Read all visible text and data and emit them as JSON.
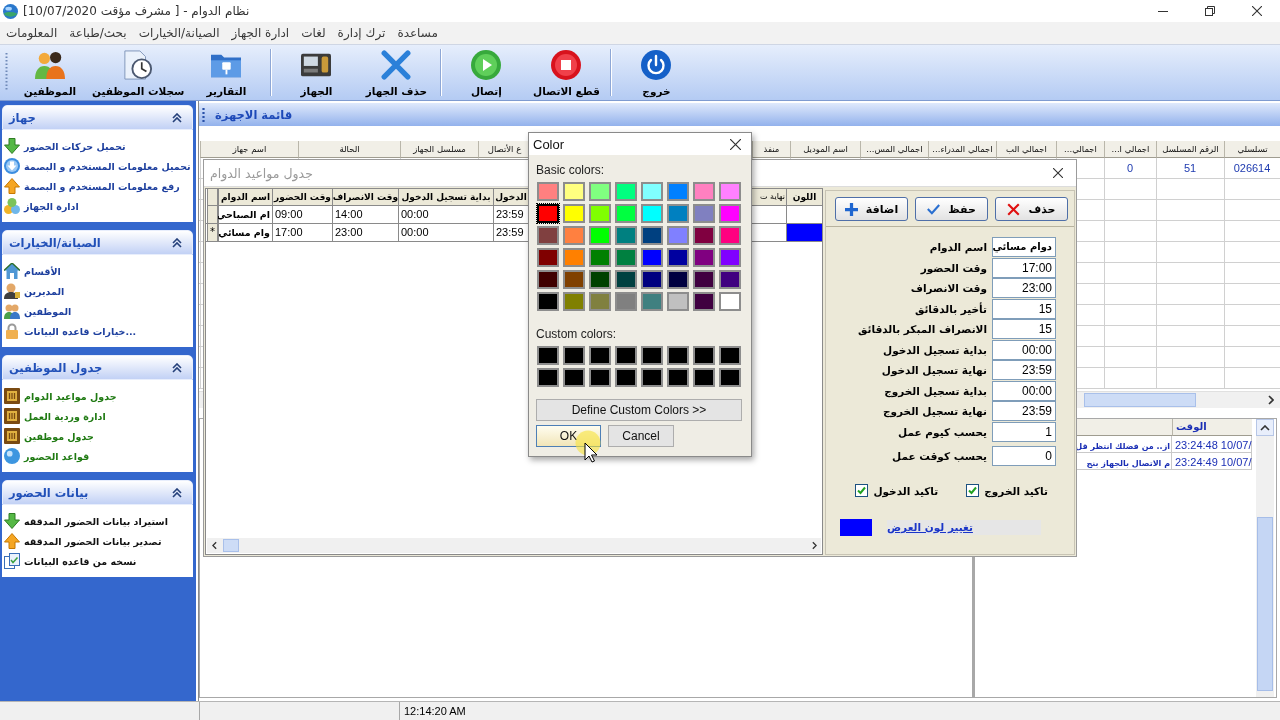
{
  "window": {
    "title": "نظام الدوام - [ مشرف مؤقت 10/07/2020]"
  },
  "menu": [
    "مساعدة",
    "ترك إدارة",
    "لغات",
    "ادارة الجهاز",
    "الصيانة/الخيارات",
    "بحث/طباعة",
    "المعلومات"
  ],
  "toolbar": [
    {
      "buttons": [
        {
          "label": "خروج"
        }
      ]
    },
    {
      "buttons": [
        {
          "label": "قطع الاتصال"
        },
        {
          "label": "إتصال"
        }
      ]
    },
    {
      "buttons": [
        {
          "label": "حذف الجهاز"
        },
        {
          "label": "الجهاز"
        }
      ]
    },
    {
      "buttons": [
        {
          "label": "التقارير"
        },
        {
          "label": "سجلات الموظفين"
        },
        {
          "label": "الموظفين"
        }
      ]
    }
  ],
  "sidebar": {
    "sections": [
      {
        "title": "جهاز",
        "expanded": true,
        "color": "#1d3f9e",
        "items": [
          "تحميل حركات الحضور",
          "تحميل معلومات المستخدم و البصمة",
          "رفع معلومات المستخدم و البصمة",
          "ادارة الجهاز"
        ]
      },
      {
        "title": "الصيانة/الخيارات",
        "expanded": true,
        "color": "#1d3f9e",
        "items": [
          "الأقسام",
          "المديرين",
          "الموظفين",
          "خيارات قاعده البيانات..."
        ]
      },
      {
        "title": "جدول الموظفين",
        "expanded": true,
        "color": "#1f7a12",
        "items": [
          "جدول مواعيد الدوام",
          "ادارة وردية العمل",
          "جدول موظفين",
          "قواعد الحضور"
        ]
      },
      {
        "title": "بيانات الحضور",
        "expanded": true,
        "color": "#111111",
        "items": [
          "استيراد بيانات الحضور المدققه",
          "تصدير بيانات الحضور المدققه",
          "نسخه من قاعده البيانات"
        ]
      }
    ]
  },
  "devices": {
    "title": "قائمة الاجهزة",
    "columns": [
      "تسلسلي",
      "الرقم المسلسل",
      "اجمالي ا...",
      "اجمالي...",
      "اجمالي الب",
      "اجمالي المدراء...",
      "اجمالي المس...",
      "اسم الموديل",
      "منفذ",
      "ع الأتصال",
      "مسلسل الجهاز",
      "الحالة",
      "اسم جهاز"
    ],
    "rows": [
      [
        "026614",
        "51",
        "0"
      ]
    ]
  },
  "log": {
    "time_header": "الوقت",
    "rows": [
      {
        "time": "23:24:48 10/07/",
        "message": "از.. من فضلك انتظر قل"
      },
      {
        "time": "23:24:49 10/07/",
        "message": "م الاتصال بالجهاز بنج"
      }
    ]
  },
  "status_bar": {
    "time": "12:14:20 AM"
  },
  "schedule": {
    "title": "جدول مواعيد الدوام",
    "columns": [
      "اللون",
      "نهاية ت",
      "الدخول",
      "بداية تسجيل الدخول",
      "وقت الانصراف",
      "وقت الحضور",
      "اسم الدوام"
    ],
    "rows": [
      {
        "cells": [
          "",
          "",
          "23:59",
          "00:00",
          "14:00",
          "09:00",
          "ام الصباحي"
        ]
      },
      {
        "color": "#0000ff",
        "cells": [
          "",
          "",
          "23:59",
          "00:00",
          "23:00",
          "17:00",
          "وام مسائي"
        ],
        "marker": "*"
      }
    ],
    "form": {
      "buttons": [
        {
          "label": "حذف"
        },
        {
          "label": "حفظ"
        },
        {
          "label": "اضافة"
        }
      ],
      "fields": [
        {
          "label": "اسم الدوام",
          "value": "دوام مسائي",
          "kind": "text"
        },
        {
          "label": "وقت الحضور",
          "value": "17:00",
          "kind": "time"
        },
        {
          "label": "وقت الانصراف",
          "value": "23:00",
          "kind": "time"
        },
        {
          "label": "تأخير بالدقائق",
          "value": "15",
          "kind": "number"
        },
        {
          "label": "الانصراف المبكر بالدقائق",
          "value": "15",
          "kind": "number"
        },
        {
          "label": "بداية تسجيل الدخول",
          "value": "00:00",
          "kind": "time"
        },
        {
          "label": "نهاية تسجيل الدخول",
          "value": "23:59",
          "kind": "time"
        },
        {
          "label": "بداية تسجيل الخروج",
          "value": "00:00",
          "kind": "time"
        },
        {
          "label": "نهاية تسجيل الخروج",
          "value": "23:59",
          "kind": "time"
        },
        {
          "label": "يحسب كيوم عمل",
          "value": "1",
          "kind": "number"
        },
        {
          "label": "يحسب كوقت عمل",
          "value": "0",
          "kind": "number"
        }
      ],
      "checks": [
        {
          "label": "تاكيد الخروج",
          "checked": true
        },
        {
          "label": "تاكيد الدخول",
          "checked": true
        }
      ],
      "color": "#0000ff",
      "color_link": "تغيير لون العرض"
    }
  },
  "color_dialog": {
    "title": "Color",
    "basic_label": "Basic colors:",
    "basic_colors": [
      {
        "color": "#ff8080",
        "selected": false
      },
      {
        "color": "#ffff80",
        "selected": false
      },
      {
        "color": "#80ff80",
        "selected": false
      },
      {
        "color": "#00ff80",
        "selected": false
      },
      {
        "color": "#80ffff",
        "selected": false
      },
      {
        "color": "#0080ff",
        "selected": false
      },
      {
        "color": "#ff80c0",
        "selected": false
      },
      {
        "color": "#ff80ff",
        "selected": false
      },
      {
        "color": "#ff0000",
        "selected": true
      },
      {
        "color": "#ffff00",
        "selected": false
      },
      {
        "color": "#80ff00",
        "selected": false
      },
      {
        "color": "#00ff40",
        "selected": false
      },
      {
        "color": "#00ffff",
        "selected": false
      },
      {
        "color": "#0080c0",
        "selected": false
      },
      {
        "color": "#8080c0",
        "selected": false
      },
      {
        "color": "#ff00ff",
        "selected": false
      },
      {
        "color": "#804040",
        "selected": false
      },
      {
        "color": "#ff8040",
        "selected": false
      },
      {
        "color": "#00ff00",
        "selected": false
      },
      {
        "color": "#008080",
        "selected": false
      },
      {
        "color": "#004080",
        "selected": false
      },
      {
        "color": "#8080ff",
        "selected": false
      },
      {
        "color": "#800040",
        "selected": false
      },
      {
        "color": "#ff0080",
        "selected": false
      },
      {
        "color": "#800000",
        "selected": false
      },
      {
        "color": "#ff8000",
        "selected": false
      },
      {
        "color": "#008000",
        "selected": false
      },
      {
        "color": "#008040",
        "selected": false
      },
      {
        "color": "#0000ff",
        "selected": false
      },
      {
        "color": "#0000a0",
        "selected": false
      },
      {
        "color": "#800080",
        "selected": false
      },
      {
        "color": "#8000ff",
        "selected": false
      },
      {
        "color": "#400000",
        "selected": false
      },
      {
        "color": "#804000",
        "selected": false
      },
      {
        "color": "#004000",
        "selected": false
      },
      {
        "color": "#004040",
        "selected": false
      },
      {
        "color": "#000080",
        "selected": false
      },
      {
        "color": "#000040",
        "selected": false
      },
      {
        "color": "#400040",
        "selected": false
      },
      {
        "color": "#400080",
        "selected": false
      },
      {
        "color": "#000000",
        "selected": false
      },
      {
        "color": "#808000",
        "selected": false
      },
      {
        "color": "#808040",
        "selected": false
      },
      {
        "color": "#808080",
        "selected": false
      },
      {
        "color": "#408080",
        "selected": false
      },
      {
        "color": "#c0c0c0",
        "selected": false
      },
      {
        "color": "#400040",
        "selected": false
      },
      {
        "color": "#ffffff",
        "selected": false
      }
    ],
    "custom_label": "Custom colors:",
    "custom_colors": [
      {
        "color": "#000000",
        "selected": false
      },
      {
        "color": "#000000",
        "selected": false
      },
      {
        "color": "#000000",
        "selected": false
      },
      {
        "color": "#000000",
        "selected": false
      },
      {
        "color": "#000000",
        "selected": false
      },
      {
        "color": "#000000",
        "selected": false
      },
      {
        "color": "#000000",
        "selected": false
      },
      {
        "color": "#000000",
        "selected": false
      },
      {
        "color": "#000000",
        "selected": false
      },
      {
        "color": "#000000",
        "selected": false
      },
      {
        "color": "#000000",
        "selected": false
      },
      {
        "color": "#000000",
        "selected": false
      },
      {
        "color": "#000000",
        "selected": false
      },
      {
        "color": "#000000",
        "selected": false
      },
      {
        "color": "#000000",
        "selected": false
      },
      {
        "color": "#000000",
        "selected": false
      }
    ],
    "define_button": "Define Custom Colors >>",
    "ok_button": "OK",
    "cancel_button": "Cancel"
  }
}
